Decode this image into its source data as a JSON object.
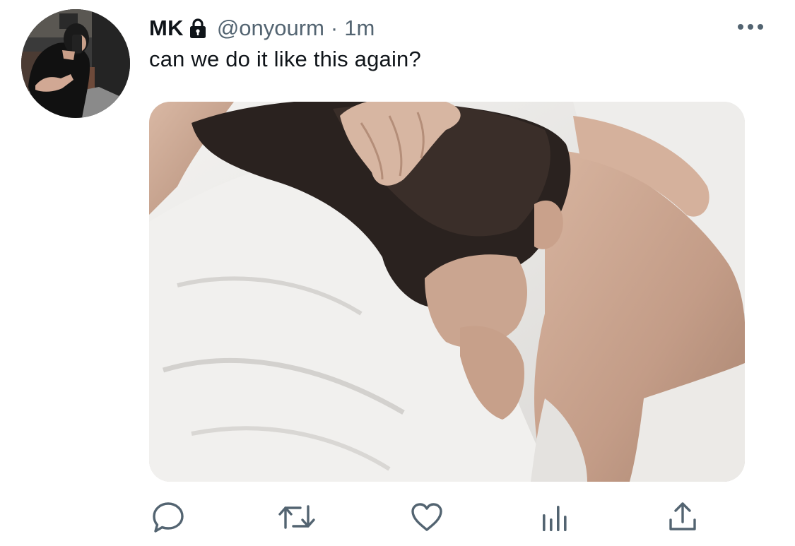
{
  "tweet": {
    "display_name": "MK",
    "handle": "@onyourm",
    "separator": "·",
    "timestamp": "1m",
    "text": "can we do it like this again?",
    "protected": true
  },
  "icons": {
    "lock": "lock-icon",
    "more": "more-options-icon",
    "reply": "reply-icon",
    "retweet": "retweet-icon",
    "like": "heart-icon",
    "analytics": "analytics-icon",
    "share": "share-icon"
  },
  "colors": {
    "text_primary": "#0f1419",
    "text_secondary": "#536471",
    "icon_gray": "#536471"
  }
}
